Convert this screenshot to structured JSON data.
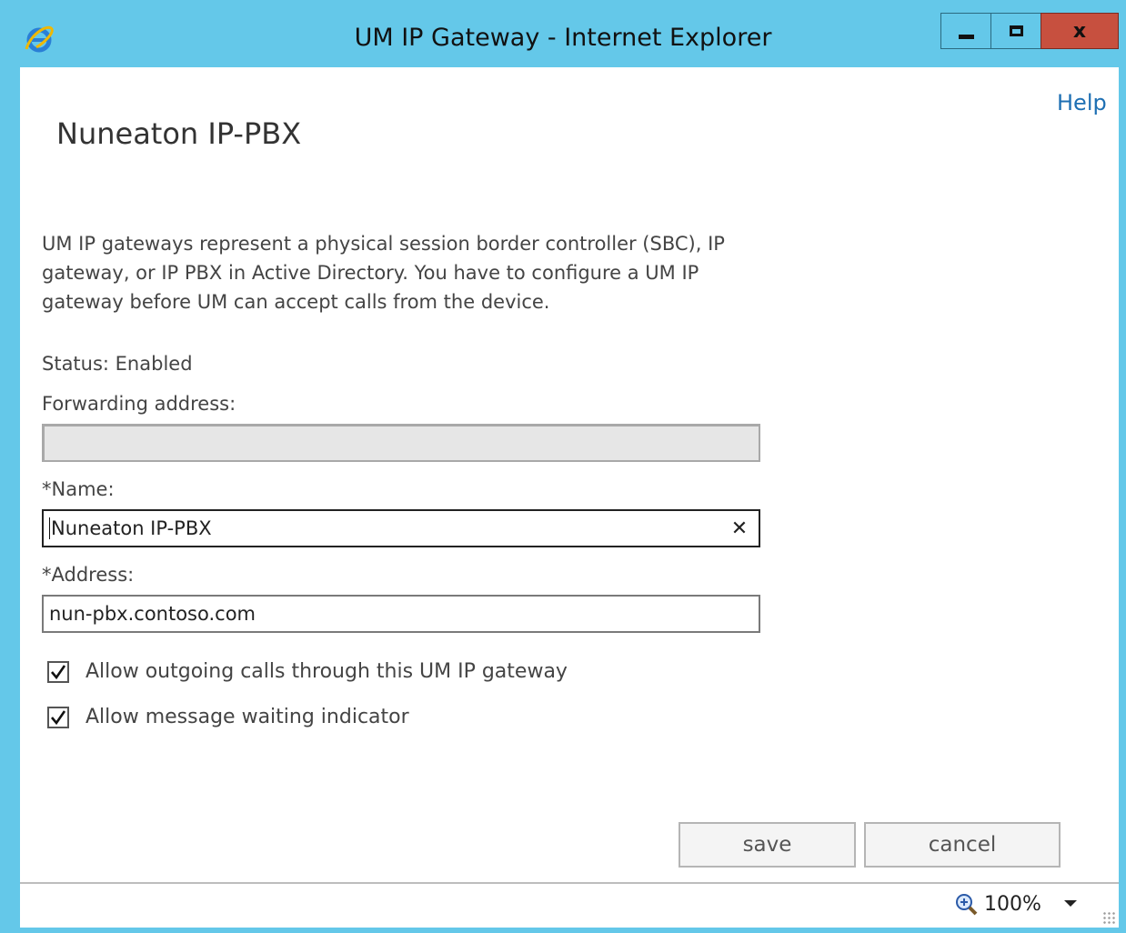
{
  "window": {
    "title": "UM IP Gateway - Internet Explorer",
    "accent_color": "#64c8e9",
    "close_color": "#c7503f",
    "controls": {
      "minimize_icon": "minimize-icon",
      "maximize_icon": "maximize-icon",
      "close_label": "x"
    }
  },
  "header": {
    "help_label": "Help",
    "page_title": "Nuneaton IP-PBX"
  },
  "form": {
    "description": "UM IP gateways represent a physical session border controller (SBC), IP gateway, or IP PBX in Active Directory. You have to configure a UM IP gateway before UM can accept calls from the device.",
    "status": "Status: Enabled",
    "forwarding_label": "Forwarding address:",
    "forwarding_value": "",
    "name_label": "*Name:",
    "name_value": "Nuneaton IP-PBX",
    "clear_label": "✕",
    "address_label": "*Address:",
    "address_value": "nun-pbx.contoso.com",
    "outgoing_calls_label": "Allow outgoing calls through this UM IP gateway",
    "outgoing_calls_checked": true,
    "mwi_label": "Allow message waiting indicator",
    "mwi_checked": true,
    "check_mark": "✔"
  },
  "actions": {
    "save_label": "save",
    "cancel_label": "cancel"
  },
  "statusbar": {
    "zoom_level": "100%"
  }
}
